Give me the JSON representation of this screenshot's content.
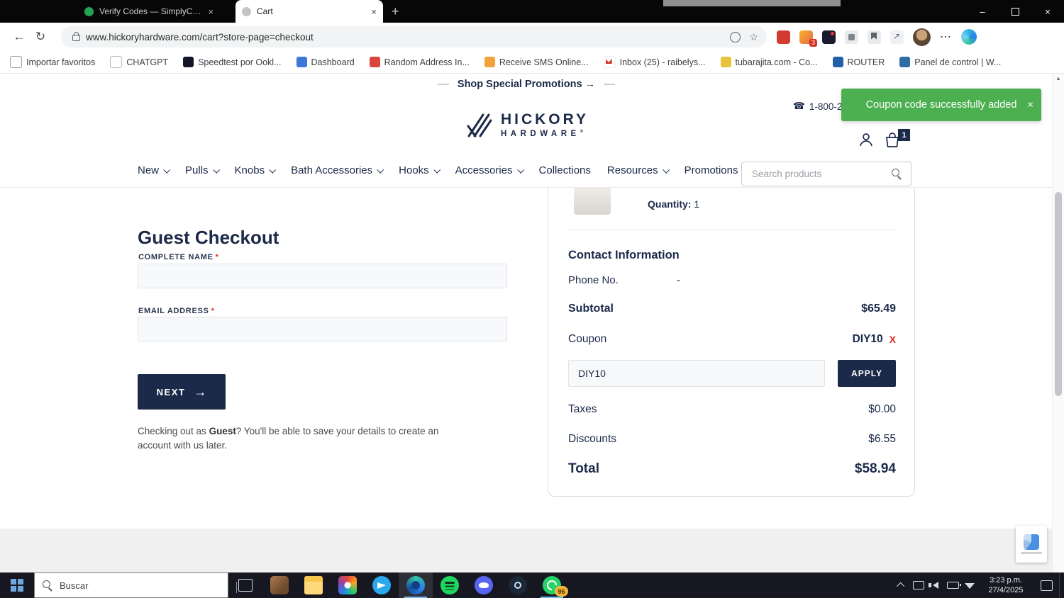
{
  "browser": {
    "tab_inactive": "Verify Codes — SimplyCodes",
    "tab_active": "Cart",
    "url": "www.hickoryhardware.com/cart?store-page=checkout",
    "ext_badge": "3",
    "bookmarks": [
      "Importar favoritos",
      "CHATGPT",
      "Speedtest por Ookl...",
      "Dashboard",
      "Random Address In...",
      "Receive SMS Online...",
      "Inbox (25) - raibelys...",
      "tubarajita.com - Co...",
      "ROUTER",
      "Panel de control | W..."
    ]
  },
  "icons": {
    "tab_close": "×",
    "new_tab": "+",
    "window_minimize": "–",
    "window_close": "×",
    "back": "←",
    "reload": "↻",
    "star": "☆",
    "ellipsis": "⋯",
    "toast_close": "×",
    "phone": "☎",
    "arrow_right": "→",
    "scroll_up": "▲"
  },
  "toast": {
    "message": "Coupon code successfully added"
  },
  "header": {
    "promo": "Shop Special Promotions →",
    "phone": "1-800-235",
    "logo_top": "HICKORY",
    "logo_bottom": "HARDWARE",
    "logo_reg": "®",
    "cart_count": "1"
  },
  "nav": {
    "items": [
      {
        "label": "New"
      },
      {
        "label": "Pulls"
      },
      {
        "label": "Knobs"
      },
      {
        "label": "Bath Accessories"
      },
      {
        "label": "Hooks"
      },
      {
        "label": "Accessories"
      },
      {
        "label": "Collections"
      },
      {
        "label": "Resources"
      },
      {
        "label": "Promotions"
      }
    ],
    "search_placeholder": "Search products"
  },
  "checkout": {
    "title": "Guest Checkout",
    "name_label": "COMPLETE NAME",
    "email_label": "EMAIL ADDRESS",
    "required_mark": "*",
    "next_label": "NEXT",
    "note_prefix": "Checking out as ",
    "note_bold": "Guest",
    "note_suffix": "? You'll be able to save your details to create an account with us later."
  },
  "summary": {
    "quantity_label": "Quantity:",
    "quantity_value": "1",
    "contact_heading": "Contact Information",
    "phone_label": "Phone No.",
    "phone_value": "-",
    "subtotal_label": "Subtotal",
    "subtotal_value": "$65.49",
    "coupon_label": "Coupon",
    "coupon_code": "DIY10",
    "coupon_remove": "X",
    "coupon_input_value": "DIY10",
    "apply_label": "APPLY",
    "taxes_label": "Taxes",
    "taxes_value": "$0.00",
    "discounts_label": "Discounts",
    "discounts_value": "$6.55",
    "total_label": "Total",
    "total_value": "$58.94"
  },
  "taskbar": {
    "search_placeholder": "Buscar",
    "whatsapp_badge": "96",
    "time": "3:23 p.m.",
    "date": "27/4/2025"
  },
  "colors": {
    "navy": "#1b2a49",
    "toast_green": "#4caf50",
    "error_red": "#e02d23"
  }
}
